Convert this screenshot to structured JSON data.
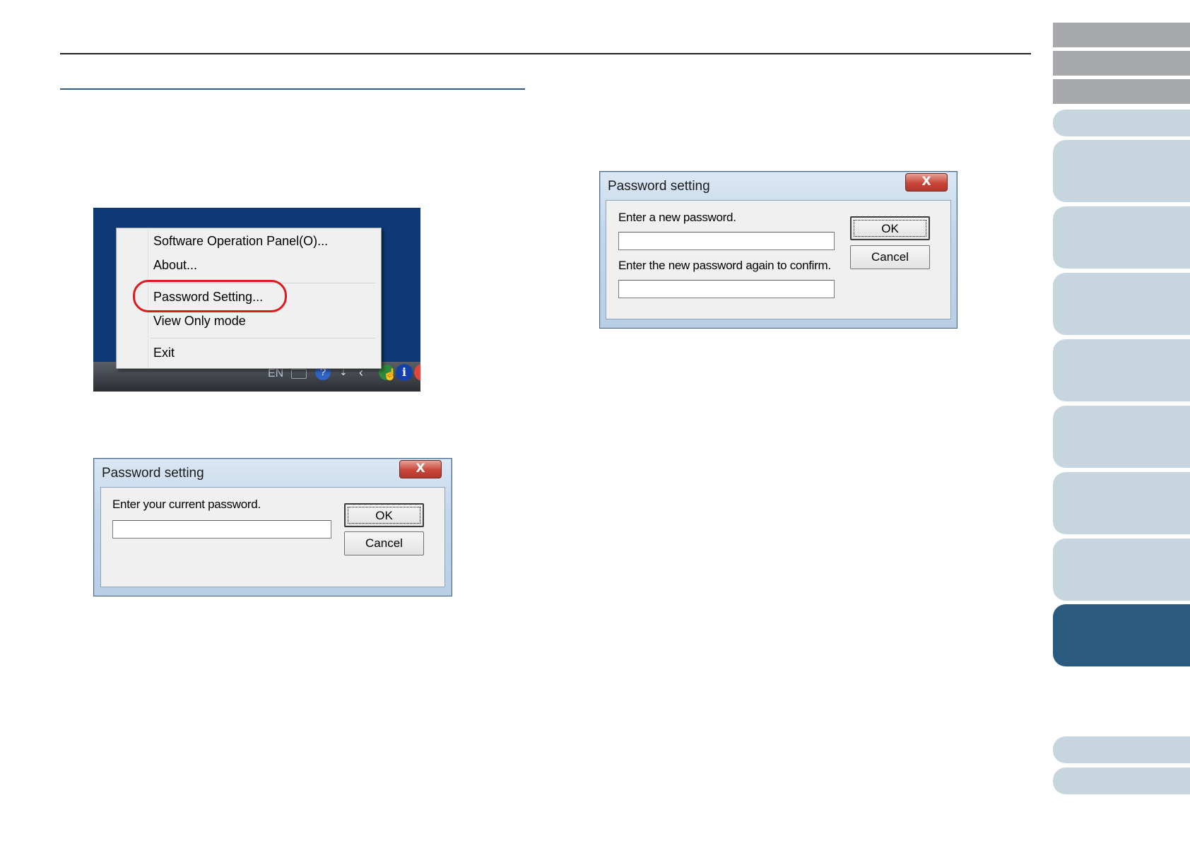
{
  "tray_menu": {
    "items": [
      "Software Operation Panel(O)...",
      "About...",
      "Password Setting...",
      "View Only mode",
      "Exit"
    ],
    "highlighted_item": "Password Setting...",
    "taskbar": {
      "language": "EN"
    }
  },
  "dialog_current": {
    "title": "Password setting",
    "prompt": "Enter your current password.",
    "password_value": "",
    "ok_label": "OK",
    "cancel_label": "Cancel",
    "close_glyph": "X"
  },
  "dialog_new": {
    "title": "Password setting",
    "prompt_new": "Enter a new password.",
    "new_password_value": "",
    "prompt_confirm": "Enter the new password again to confirm.",
    "confirm_password_value": "",
    "ok_label": "OK",
    "cancel_label": "Cancel",
    "close_glyph": "X"
  },
  "colors": {
    "highlight_ring": "#e0171b",
    "desktop_blue": "#0d3a74",
    "tab_gray": "#a7a9ac",
    "tab_light": "#c7d6de",
    "tab_active": "#2a5b7e",
    "section_rule": "#2e5d86"
  }
}
